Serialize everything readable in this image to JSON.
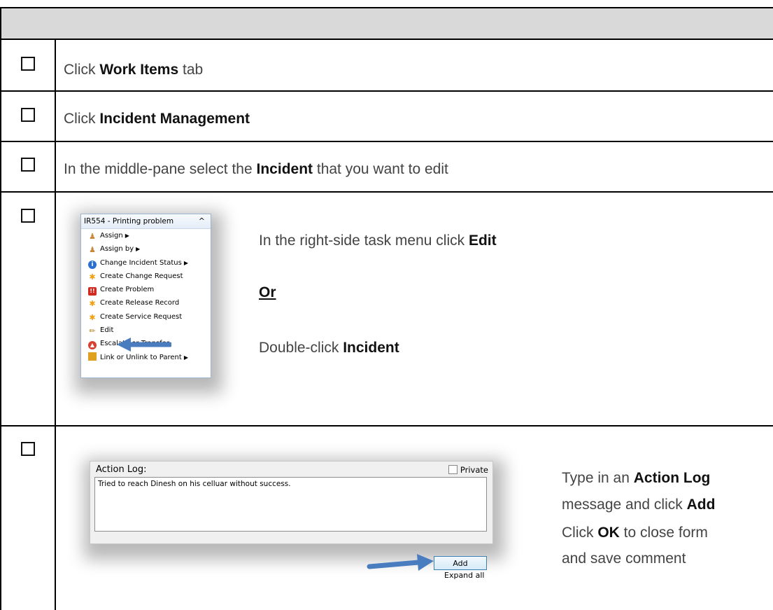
{
  "steps": [
    {
      "pre": "Click ",
      "bold": "Work Items",
      "post": " tab"
    },
    {
      "pre": "Click ",
      "bold": "Incident Management",
      "post": ""
    },
    {
      "pre": "In the middle-pane select the ",
      "bold": "Incident",
      "post": " that you want to edit"
    }
  ],
  "step4": {
    "line1_pre": "In the right-side task menu click ",
    "line1_bold": "Edit",
    "or": "Or",
    "line2_pre": "Double-click ",
    "line2_bold": "Incident"
  },
  "menu": {
    "title": "IR554 - Printing problem",
    "items": [
      {
        "label": "Assign",
        "icon": "user-icon",
        "submenu": true
      },
      {
        "label": "Assign by",
        "icon": "user-icon",
        "submenu": true
      },
      {
        "label": "Change Incident Status",
        "icon": "info-icon",
        "submenu": true
      },
      {
        "label": "Create Change Request",
        "icon": "star-icon",
        "submenu": false
      },
      {
        "label": "Create Problem",
        "icon": "problem-icon",
        "submenu": false
      },
      {
        "label": "Create Release Record",
        "icon": "star-icon",
        "submenu": false
      },
      {
        "label": "Create Service Request",
        "icon": "star-icon",
        "submenu": false
      },
      {
        "label": "Edit",
        "icon": "pencil-icon",
        "submenu": false
      },
      {
        "label": "Escalate or Transfer",
        "icon": "escalate-icon",
        "submenu": false
      },
      {
        "label": "Link or Unlink to Parent",
        "icon": "link-icon",
        "submenu": true
      }
    ]
  },
  "action_log": {
    "title": "Action Log:",
    "private_label": "Private",
    "message": "Tried to reach Dinesh on his celluar without success.",
    "add_label": "Add",
    "expand_label": "Expand all"
  },
  "step5": {
    "l1_pre": "Type in an ",
    "l1_bold": "Action Log",
    "l2_pre": "message and click ",
    "l2_bold": "Add",
    "l3_pre": "Click ",
    "l3_bold": "OK",
    "l3_post": " to close form",
    "l4": "and save comment"
  },
  "colors": {
    "header_fill": "#d9d9d9",
    "arrow": "#4a7cc0"
  }
}
